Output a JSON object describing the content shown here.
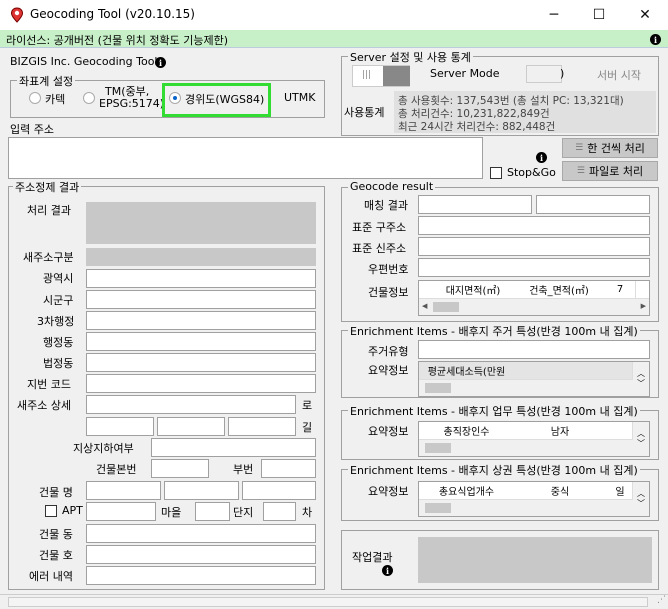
{
  "window": {
    "title": "Geocoding Tool  (v20.10.15)",
    "minimize": "─",
    "maximize": "☐",
    "close": "✕"
  },
  "license": "라이선스: 공개버전 (건물 위치 정확도 기능제한)",
  "brand": "BIZGIS Inc. Geocoding Tool",
  "coord": {
    "legend": "좌표계 설정",
    "opt1": "카텍",
    "opt2a": "TM(중부,",
    "opt2b": "EPSG:5174)",
    "opt3": "경위도(WGS84)",
    "opt4": "UTMK",
    "selected": "경위도(WGS84)"
  },
  "server": {
    "legend": "Server 설정 및 사용 통계",
    "toggle": "|||",
    "mode_label": "Server Mode",
    "paren": ")",
    "start": "서버 시작",
    "stats_label": "사용통계",
    "stat1": "총 사용횟수: 137,543번 (총 설치 PC: 13,321대)",
    "stat2": "총 처리건수: 10,231,822,849건",
    "stat3": "최근 24시간 처리건수: 882,448건"
  },
  "input": {
    "label": "입력 주소",
    "stopgo": "Stop&Go",
    "single_btn": "한 건씩 처리",
    "file_btn": "파일로 처리"
  },
  "refine": {
    "legend": "주소정제 결과",
    "result": "처리 결과",
    "addr_type": "새주소구분",
    "sido": "광역시",
    "sigungu": "시군구",
    "admin3": "3차행정",
    "haeng": "행정동",
    "bub": "법정동",
    "jibun": "지번 코드",
    "detail": "새주소 상세",
    "ro": "로",
    "gil": "길",
    "underground": "지상지하여부",
    "main_no": "건물본번",
    "sub_no": "부번",
    "bldg_name": "건물 명",
    "apt": "APT",
    "village": "마을",
    "complex": "단지",
    "cha": "차",
    "bldg_dong": "건물 동",
    "bldg_ho": "건물 호",
    "error": "에러 내역"
  },
  "geocode": {
    "legend": "Geocode result",
    "match": "매칭 결과",
    "std_old": "표준 구주소",
    "std_new": "표준 신주소",
    "postal": "우편번호",
    "bldg_info": "건물정보",
    "col1": "대지면적(㎡)",
    "col2": "건축_면적(㎡)",
    "col3": "7"
  },
  "enrich_home": {
    "legend": "Enrichment Items - 배후지 주거 특성(반경 100m 내 집계)",
    "type": "주거유형",
    "summary": "요약정보",
    "col1": "평균세대소득(만원"
  },
  "enrich_work": {
    "legend": "Enrichment Items - 배후지 업무 특성(반경 100m 내 집계)",
    "summary": "요약정보",
    "col1": "총직장인수",
    "col2": "남자"
  },
  "enrich_shop": {
    "legend": "Enrichment Items - 배후지 상권 특성(반경 100m 내 집계)",
    "summary": "요약정보",
    "col1": "총요식업개수",
    "col2": "중식",
    "col3": "일"
  },
  "work": {
    "label": "작업결과"
  },
  "colors": {
    "license_bg": "#c8f0c8",
    "highlight": "#32dc32",
    "gray_box": "#c8c8c8"
  }
}
